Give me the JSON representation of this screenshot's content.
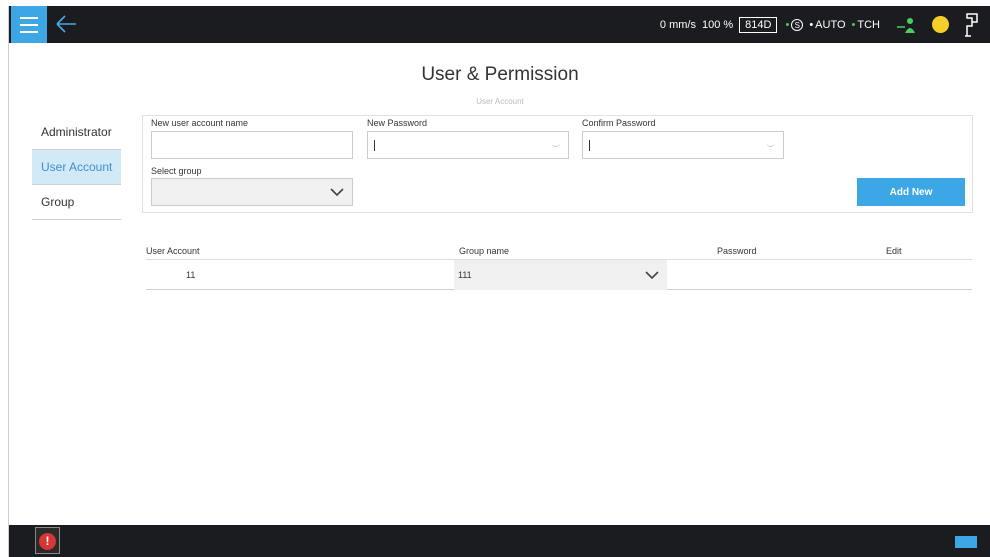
{
  "header": {
    "speed": "0 mm/s",
    "override": "100 %",
    "mode_code": "814D",
    "status_s": "S",
    "auto_label": "AUTO",
    "tch_label": "TCH",
    "accent_color": "#3da7e6",
    "status_green": "#4ad05d",
    "status_yellow": "#f3cf29"
  },
  "page": {
    "title": "User & Permission",
    "subtitle": "User Account"
  },
  "sidebar": {
    "items": [
      {
        "label": "Administrator"
      },
      {
        "label": "User Account"
      },
      {
        "label": "Group"
      }
    ],
    "active_index": 1
  },
  "form": {
    "new_name_label": "New user account name",
    "new_name_value": "",
    "new_password_label": "New Password",
    "new_password_value": "",
    "confirm_password_label": "Confirm Password",
    "confirm_password_value": "",
    "select_group_label": "Select group",
    "select_group_value": "",
    "add_button_label": "Add New"
  },
  "table": {
    "headers": [
      "User Account",
      "Group name",
      "Password",
      "Edit"
    ],
    "rows": [
      {
        "user": "11",
        "group": "111",
        "password": "",
        "edit": ""
      }
    ]
  },
  "footer": {
    "alarm_glyph": "!"
  }
}
